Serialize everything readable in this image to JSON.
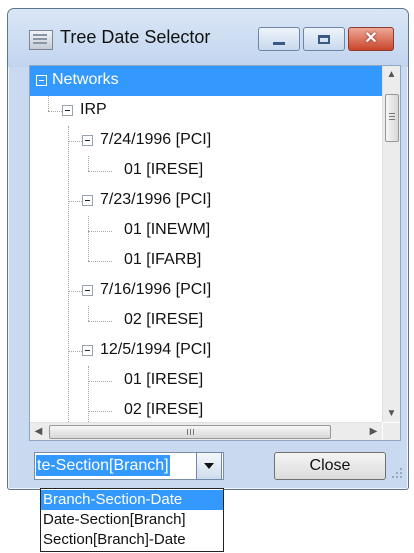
{
  "window": {
    "title": "Tree Date Selector"
  },
  "tree": {
    "rows": [
      {
        "label": "Networks",
        "selected": true
      },
      {
        "label": "IRP"
      },
      {
        "label": "7/24/1996 [PCI]"
      },
      {
        "label": "01 [IRESE]"
      },
      {
        "label": "7/23/1996 [PCI]"
      },
      {
        "label": "01 [INEWM]"
      },
      {
        "label": "01 [IFARB]"
      },
      {
        "label": "7/16/1996 [PCI]"
      },
      {
        "label": "02 [IRESE]"
      },
      {
        "label": "12/5/1994 [PCI]"
      },
      {
        "label": "01 [IRESE]"
      },
      {
        "label": "02 [IRESE]"
      }
    ]
  },
  "footer": {
    "combo_value": "te-Section[Branch]",
    "close_label": "Close"
  },
  "dropdown": {
    "options": [
      "Branch-Section-Date",
      "Date-Section[Branch]",
      "Section[Branch]-Date"
    ],
    "highlighted_index": 0
  },
  "colors": {
    "selection": "#3399ff"
  }
}
